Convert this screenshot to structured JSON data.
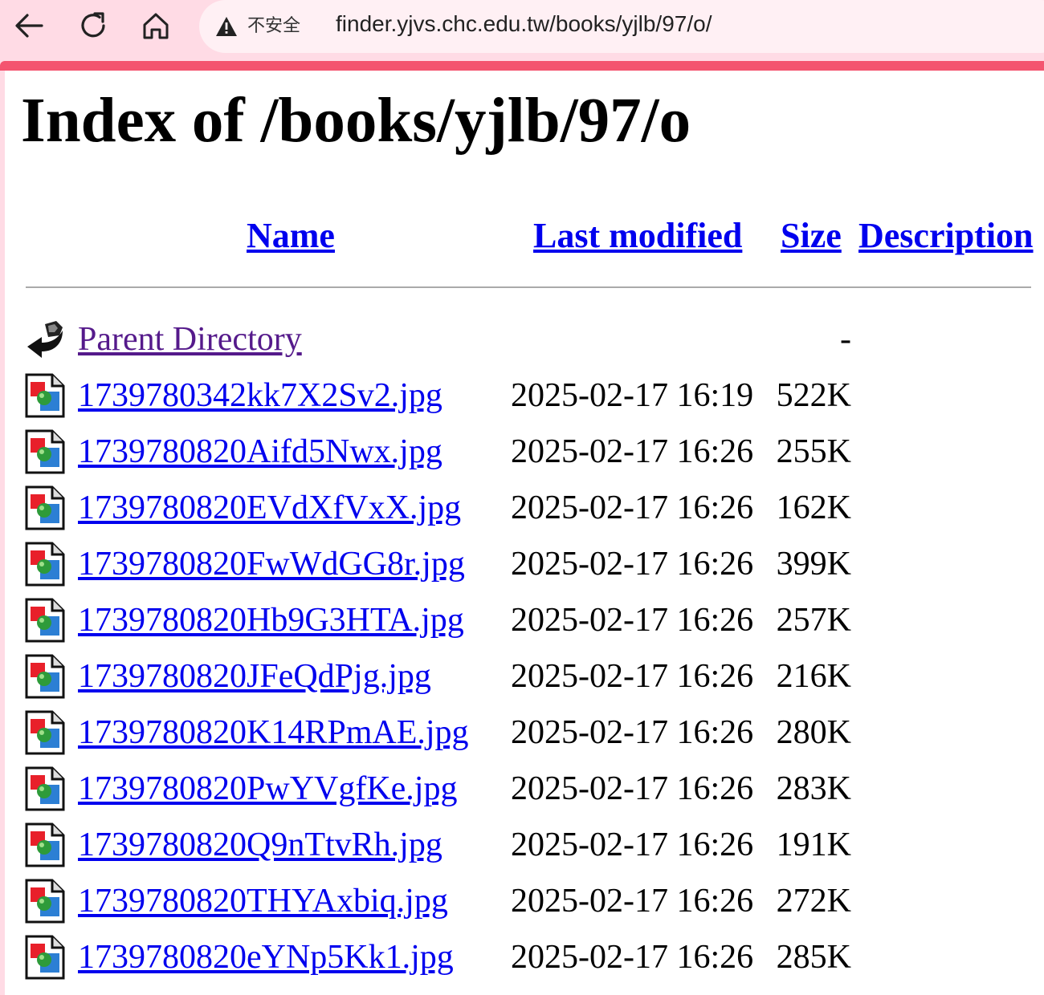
{
  "browser": {
    "security_label": "不安全",
    "url": "finder.yjvs.chc.edu.tw/books/yjlb/97/o/"
  },
  "page": {
    "title": "Index of /books/yjlb/97/o",
    "columns": {
      "name": "Name",
      "last_modified": "Last modified",
      "size": "Size",
      "description": "Description"
    },
    "parent": {
      "label": "Parent Directory",
      "size": "-"
    },
    "files": [
      {
        "name": "1739780342kk7X2Sv2.jpg",
        "modified": "2025-02-17 16:19",
        "size": "522K"
      },
      {
        "name": "1739780820Aifd5Nwx.jpg",
        "modified": "2025-02-17 16:26",
        "size": "255K"
      },
      {
        "name": "1739780820EVdXfVxX.jpg",
        "modified": "2025-02-17 16:26",
        "size": "162K"
      },
      {
        "name": "1739780820FwWdGG8r.jpg",
        "modified": "2025-02-17 16:26",
        "size": "399K"
      },
      {
        "name": "1739780820Hb9G3HTA.jpg",
        "modified": "2025-02-17 16:26",
        "size": "257K"
      },
      {
        "name": "1739780820JFeQdPjg.jpg",
        "modified": "2025-02-17 16:26",
        "size": "216K"
      },
      {
        "name": "1739780820K14RPmAE.jpg",
        "modified": "2025-02-17 16:26",
        "size": "280K"
      },
      {
        "name": "1739780820PwYVgfKe.jpg",
        "modified": "2025-02-17 16:26",
        "size": "283K"
      },
      {
        "name": "1739780820Q9nTtvRh.jpg",
        "modified": "2025-02-17 16:26",
        "size": "191K"
      },
      {
        "name": "1739780820THYAxbiq.jpg",
        "modified": "2025-02-17 16:26",
        "size": "272K"
      },
      {
        "name": "1739780820eYNp5Kk1.jpg",
        "modified": "2025-02-17 16:26",
        "size": "285K"
      }
    ]
  },
  "icons": {
    "back": "back-arrow-icon",
    "reload": "reload-icon",
    "home": "home-icon",
    "warning": "warning-triangle-icon",
    "parent": "parent-directory-icon",
    "image_file": "image-file-icon"
  },
  "colors": {
    "chrome_bg": "#ffdbe5",
    "accent": "#f4546f",
    "link": "#0000ee",
    "visited_link": "#551a8b"
  }
}
